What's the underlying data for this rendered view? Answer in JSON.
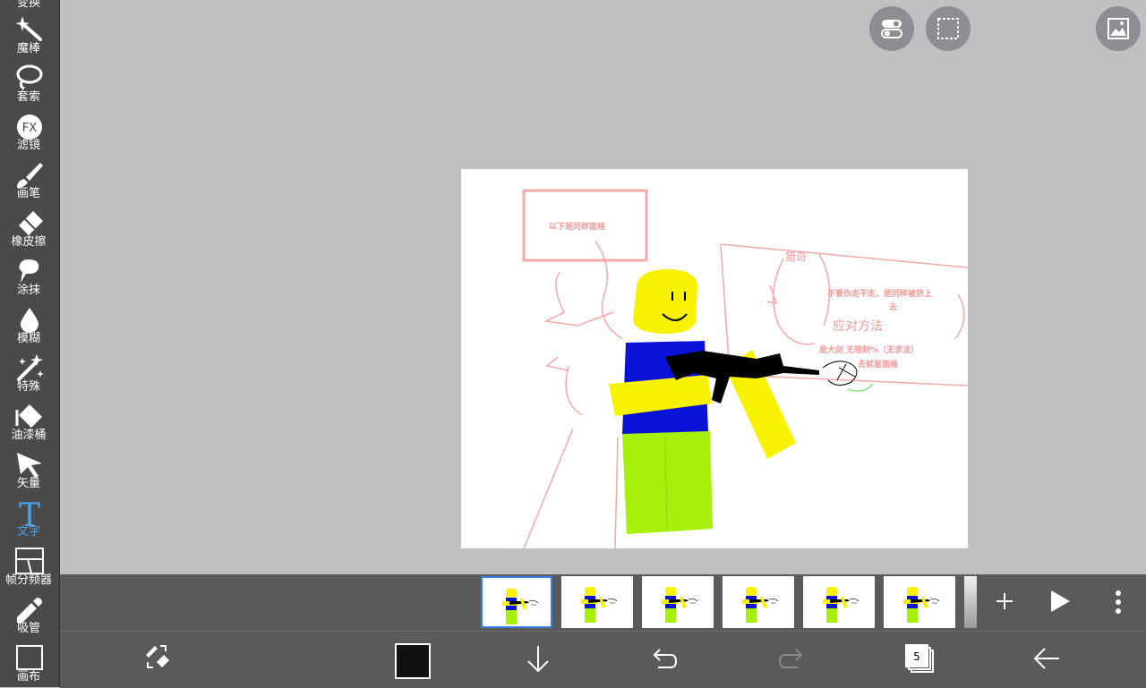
{
  "sidebar": {
    "partial_label": "变换",
    "tools": [
      {
        "label": "魔棒",
        "icon": "magic-wand-icon"
      },
      {
        "label": "套索",
        "icon": "lasso-icon"
      },
      {
        "label": "滤镜",
        "icon": "fx-filter-icon"
      },
      {
        "label": "画笔",
        "icon": "brush-icon"
      },
      {
        "label": "橡皮擦",
        "icon": "eraser-icon"
      },
      {
        "label": "涂抹",
        "icon": "smudge-icon"
      },
      {
        "label": "模糊",
        "icon": "blur-drop-icon"
      },
      {
        "label": "特殊",
        "icon": "special-sparkle-icon"
      },
      {
        "label": "油漆桶",
        "icon": "paint-bucket-icon"
      },
      {
        "label": "矢量",
        "icon": "vector-cursor-icon"
      },
      {
        "label": "文字",
        "icon": "text-tool-icon",
        "active": true
      },
      {
        "label": "帧分频器",
        "icon": "frame-divider-icon"
      },
      {
        "label": "吸管",
        "icon": "eyedropper-icon"
      },
      {
        "label": "画布",
        "icon": "canvas-icon"
      }
    ],
    "fx_glyph": "FX",
    "text_glyph": "T",
    "active_color": "#4aa3e8"
  },
  "canvas_text": {
    "box_title": "以下是同样面格",
    "note_line1": "不管你走不走，是同样被挤上",
    "note_line2": "去",
    "handwritten": "应对方法",
    "note_line3": "是大剑 无限制%（无求法）",
    "note_line4": "去就是面格",
    "scribble_top": "猎奇"
  },
  "top_controls": {
    "toggle": "toggle-settings-icon",
    "selection": "selection-marquee-icon",
    "gallery": "image-gallery-icon"
  },
  "frames": {
    "count": 6,
    "selected_index": 0
  },
  "bottom_bar": {
    "color": "#111111",
    "layer_count": "5"
  }
}
